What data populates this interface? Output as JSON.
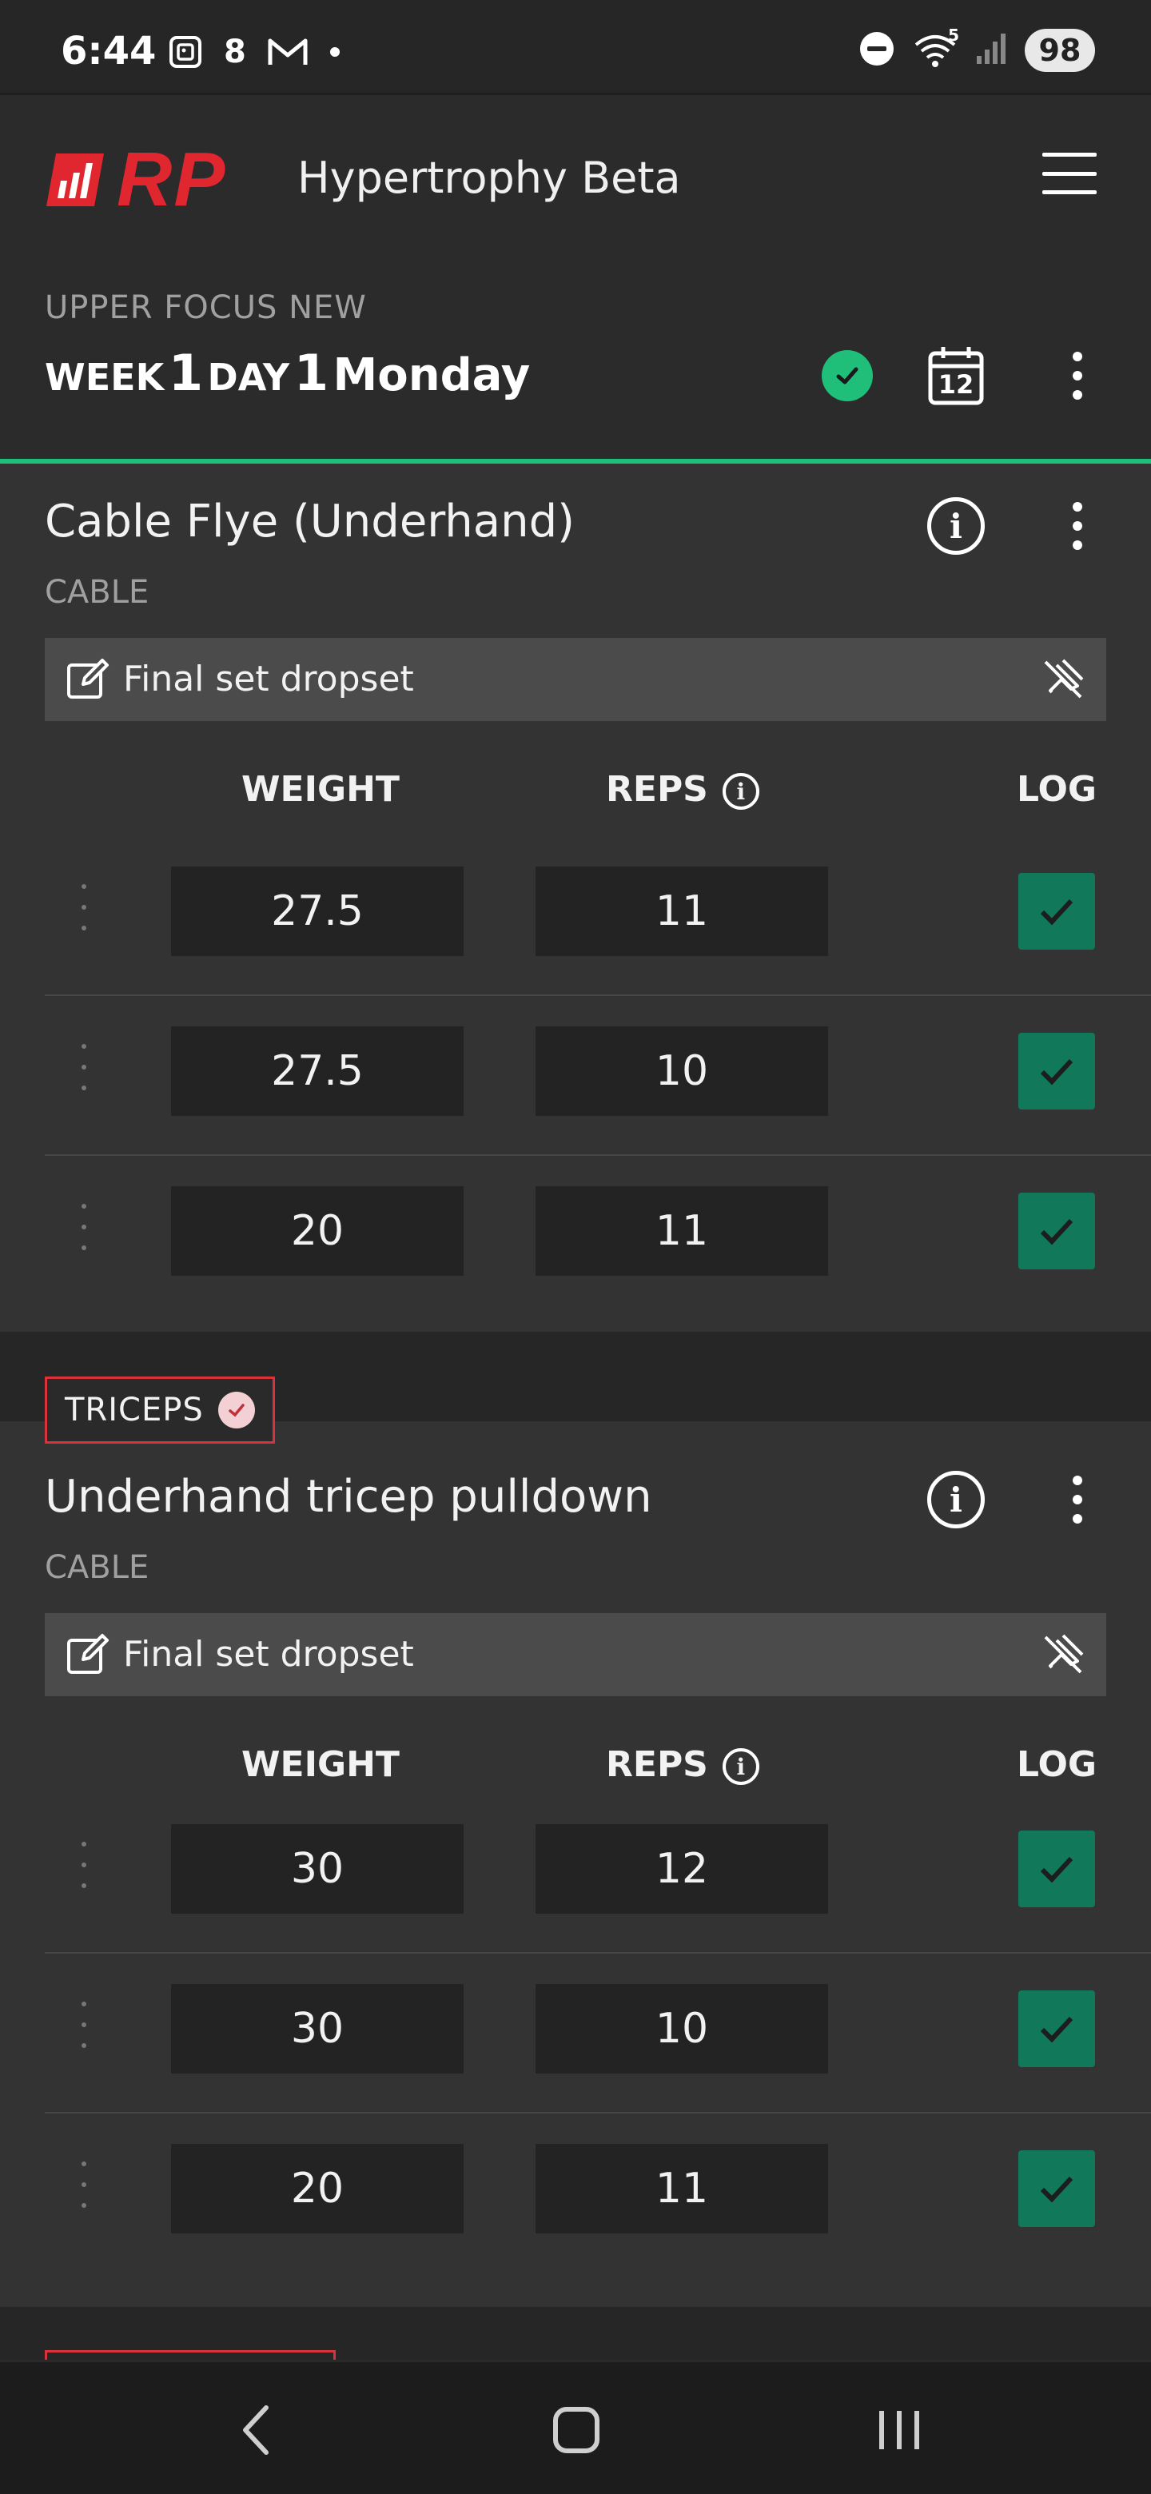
{
  "status_bar": {
    "time": "6:44",
    "notification_count": "8",
    "wifi_badge": "5",
    "battery": "98"
  },
  "app": {
    "logo": "RP",
    "title": "Hypertrophy Beta"
  },
  "workout": {
    "meso": "UPPER FOCUS NEW",
    "week_label": "WEEK",
    "week_num": "1",
    "day_label": "DAY",
    "day_num": "1",
    "weekday": "Monday",
    "calendar_day": "12"
  },
  "exercises": [
    {
      "name": "Cable Flye (Underhand)",
      "equipment": "CABLE",
      "note": "Final set dropset",
      "headers": {
        "weight": "WEIGHT",
        "reps": "REPS",
        "log": "LOG"
      },
      "sets": [
        {
          "weight": "27.5",
          "reps": "11",
          "logged": true
        },
        {
          "weight": "27.5",
          "reps": "10",
          "logged": true
        },
        {
          "weight": "20",
          "reps": "11",
          "logged": true
        }
      ]
    },
    {
      "muscle_group": "TRICEPS",
      "name": "Underhand tricep pulldown",
      "equipment": "CABLE",
      "note": "Final set dropset",
      "headers": {
        "weight": "WEIGHT",
        "reps": "REPS",
        "log": "LOG"
      },
      "sets": [
        {
          "weight": "30",
          "reps": "12",
          "logged": true
        },
        {
          "weight": "30",
          "reps": "10",
          "logged": true
        },
        {
          "weight": "20",
          "reps": "11",
          "logged": true
        }
      ]
    }
  ],
  "colors": {
    "accent_green": "#1fbf7a",
    "log_green": "#11795a",
    "brand_red": "#e0262f"
  }
}
